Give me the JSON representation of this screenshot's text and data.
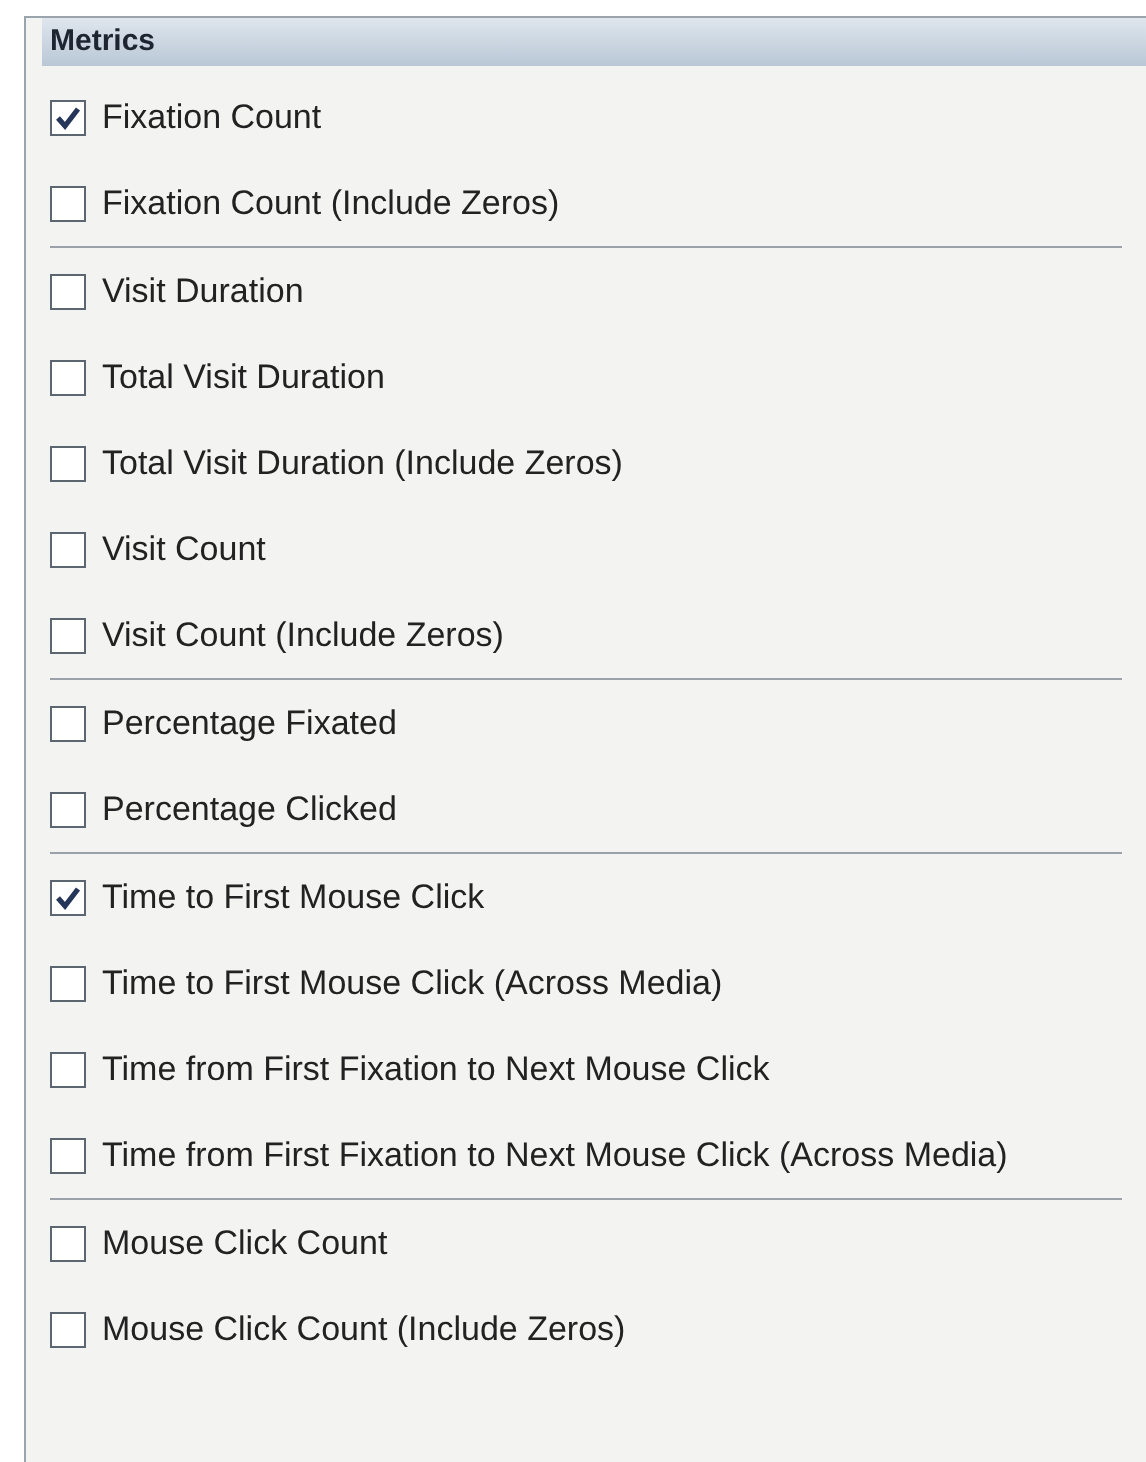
{
  "panel": {
    "title": "Metrics"
  },
  "groups": [
    {
      "items": [
        {
          "label": "Fixation Count",
          "checked": true
        },
        {
          "label": "Fixation Count (Include Zeros)",
          "checked": false
        }
      ]
    },
    {
      "items": [
        {
          "label": "Visit Duration",
          "checked": false
        },
        {
          "label": "Total Visit Duration",
          "checked": false
        },
        {
          "label": "Total Visit Duration (Include Zeros)",
          "checked": false
        },
        {
          "label": "Visit Count",
          "checked": false
        },
        {
          "label": "Visit Count (Include Zeros)",
          "checked": false
        }
      ]
    },
    {
      "items": [
        {
          "label": "Percentage Fixated",
          "checked": false
        },
        {
          "label": "Percentage Clicked",
          "checked": false
        }
      ]
    },
    {
      "items": [
        {
          "label": "Time to First Mouse Click",
          "checked": true
        },
        {
          "label": "Time to First Mouse Click (Across Media)",
          "checked": false
        },
        {
          "label": "Time from First Fixation to Next Mouse Click",
          "checked": false
        },
        {
          "label": "Time from First Fixation to Next Mouse Click (Across Media)",
          "checked": false
        }
      ]
    },
    {
      "items": [
        {
          "label": "Mouse Click Count",
          "checked": false
        },
        {
          "label": "Mouse Click Count (Include Zeros)",
          "checked": false
        }
      ]
    }
  ]
}
